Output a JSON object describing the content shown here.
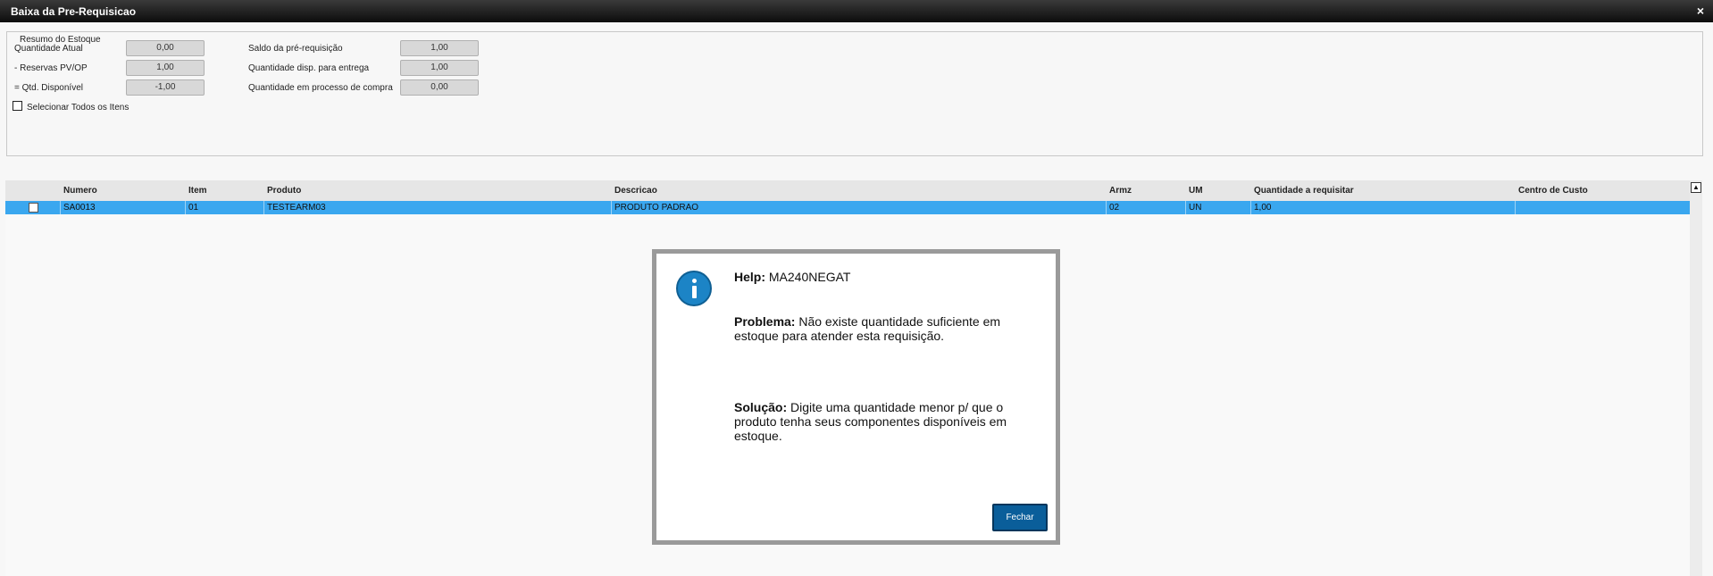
{
  "window": {
    "title": "Baixa da Pre-Requisicao",
    "close_glyph": "×"
  },
  "summary": {
    "legend": "Resumo do Estoque",
    "quantidade_atual": {
      "label": "Quantidade Atual",
      "value": "0,00"
    },
    "reservas": {
      "label": "- Reservas PV/OP",
      "value": "1,00"
    },
    "disponivel": {
      "label": "= Qtd. Disponível",
      "value": "-1,00"
    },
    "saldo": {
      "label": "Saldo da pré-requisição",
      "value": "1,00"
    },
    "disp_entrega": {
      "label": "Quantidade disp. para entrega",
      "value": "1,00"
    },
    "processo_compra": {
      "label": "Quantidade em processo de compra",
      "value": "0,00"
    },
    "select_all_label": "Selecionar Todos os Itens"
  },
  "grid": {
    "headers": [
      "Numero",
      "Item",
      "Produto",
      "Descricao",
      "Armz",
      "UM",
      "Quantidade a requisitar",
      "Centro de Custo"
    ],
    "rows": [
      {
        "numero": "SA0013",
        "item": "01",
        "produto": "TESTEARM03",
        "descricao": "PRODUTO PADRAO",
        "armz": "02",
        "um": "UN",
        "quantidade": "1,00",
        "centro_custo": ""
      }
    ]
  },
  "dialog": {
    "icon": "info-icon",
    "help_label": "Help:",
    "help_code": "MA240NEGAT",
    "problema_label": "Problema:",
    "problema_text": "Não existe quantidade suficiente em estoque para atender esta requisição.",
    "solucao_label": "Solução:",
    "solucao_text": "Digite uma quantidade menor p/ que o produto tenha seus componentes disponíveis em estoque.",
    "button_label": "Fechar"
  }
}
